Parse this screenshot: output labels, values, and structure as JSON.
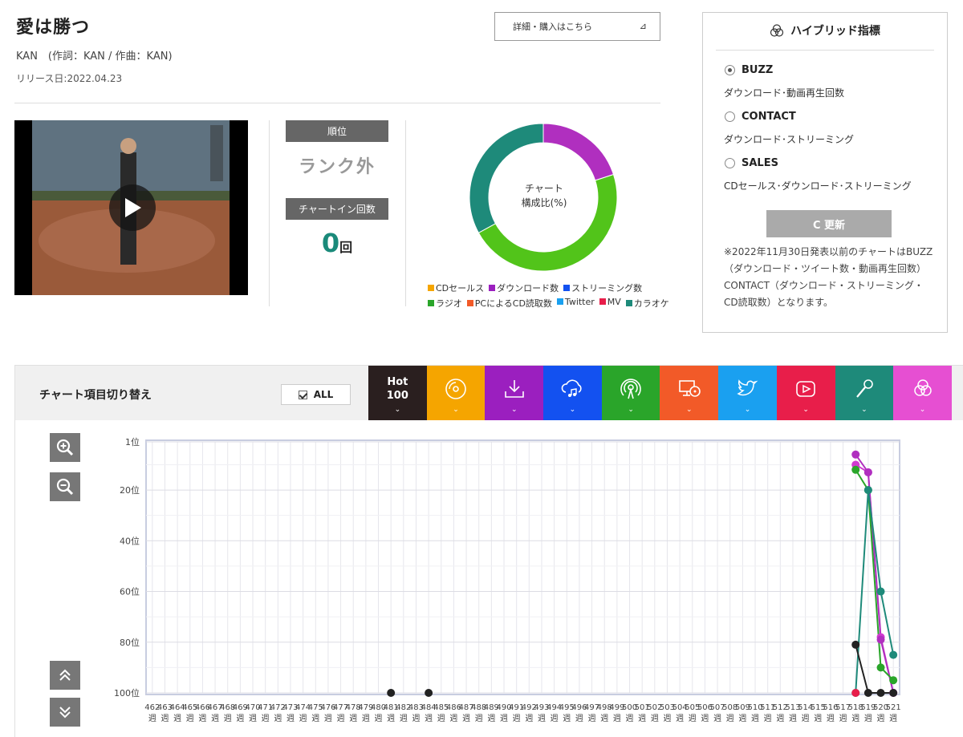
{
  "song": {
    "title": "愛は勝つ",
    "artist_line": "KAN　(作詞：KAN / 作曲：KAN)",
    "release": "リリース日:2022.04.23",
    "detail_button": "詳細・購入はこちら",
    "detail_arrow": "⊿"
  },
  "stats": {
    "rank_label": "順位",
    "rank_value": "ランク外",
    "chart_in_label": "チャートイン回数",
    "chart_in_count": "0",
    "chart_in_unit": "回"
  },
  "donut": {
    "center_line1": "チャート",
    "center_line2": "構成比(%)",
    "slices": [
      {
        "name": "ダウンロード数",
        "value": 20,
        "color": "#b02fbf"
      },
      {
        "name": "ラジオ",
        "value": 47,
        "color": "#52c41a"
      },
      {
        "name": "カラオケ",
        "value": 33,
        "color": "#1e8a7a"
      }
    ],
    "legend_row1": [
      {
        "label": "CDセールス",
        "color": "#f5a500"
      },
      {
        "label": "ダウンロード数",
        "color": "#9b1fbf"
      },
      {
        "label": "ストリーミング数",
        "color": "#1351f0"
      }
    ],
    "legend_row2": [
      {
        "label": "ラジオ",
        "color": "#2aa52a"
      },
      {
        "label": "PCによるCD読取数",
        "color": "#f25a28"
      },
      {
        "label": "Twitter",
        "color": "#1aa0f0"
      },
      {
        "label": "MV",
        "color": "#e81e4a"
      },
      {
        "label": "カラオケ",
        "color": "#1e8a7a"
      }
    ]
  },
  "hybrid": {
    "title": "ハイブリッド指標",
    "options": [
      {
        "label": "BUZZ",
        "desc": "ダウンロード･動画再生回数",
        "selected": true
      },
      {
        "label": "CONTACT",
        "desc": "ダウンロード･ストリーミング",
        "selected": false
      },
      {
        "label": "SALES",
        "desc": "CDセールス･ダウンロード･ストリーミング",
        "selected": false
      }
    ],
    "refresh_label": "C 更新",
    "note": "※2022年11月30日発表以前のチャートはBUZZ（ダウンロード・ツイート数・動画再生回数）CONTACT（ダウンロード・ストリーミング・CD読取数）となります。"
  },
  "chart_panel": {
    "title": "チャート項目切り替え",
    "all_label": "ALL",
    "hot_line1": "Hot",
    "hot_line2": "100",
    "categories": [
      {
        "name": "hot100",
        "color": "#2a1f1f",
        "icon": "hot100"
      },
      {
        "name": "cd-sales",
        "color": "#f5a500",
        "icon": "disc-icon"
      },
      {
        "name": "download",
        "color": "#9b1fbf",
        "icon": "download-icon"
      },
      {
        "name": "streaming",
        "color": "#1351f0",
        "icon": "cloud-music-icon"
      },
      {
        "name": "radio",
        "color": "#2aa52a",
        "icon": "radio-icon"
      },
      {
        "name": "pc-cd-read",
        "color": "#f25a28",
        "icon": "pc-disc-icon"
      },
      {
        "name": "twitter",
        "color": "#1aa0f0",
        "icon": "twitter-icon"
      },
      {
        "name": "mv",
        "color": "#e81e4a",
        "icon": "video-icon"
      },
      {
        "name": "karaoke",
        "color": "#1e8a7a",
        "icon": "mic-icon"
      },
      {
        "name": "hybrid",
        "color": "#e64fd2",
        "icon": "hybrid-icon"
      }
    ]
  },
  "chart_data": {
    "type": "line",
    "y_tick_labels": [
      "1位",
      "20位",
      "40位",
      "60位",
      "80位",
      "100位"
    ],
    "y_ticks": [
      1,
      20,
      40,
      60,
      80,
      100
    ],
    "ylim": [
      1,
      100
    ],
    "y_inverted": true,
    "x_labels": [
      "462",
      "463",
      "464",
      "465",
      "466",
      "467",
      "468",
      "469",
      "470",
      "471",
      "472",
      "473",
      "474",
      "475",
      "476",
      "477",
      "478",
      "479",
      "480",
      "481",
      "482",
      "483",
      "484",
      "485",
      "486",
      "487",
      "488",
      "489",
      "490",
      "491",
      "492",
      "493",
      "494",
      "495",
      "496",
      "497",
      "498",
      "499",
      "500",
      "501",
      "502",
      "503",
      "504",
      "505",
      "506",
      "507",
      "508",
      "509",
      "510",
      "511",
      "512",
      "513",
      "514",
      "515",
      "516",
      "517",
      "518",
      "519",
      "520",
      "521"
    ],
    "x_suffix": "週",
    "series": [
      {
        "color": "#d03ad0",
        "points": [
          [
            56,
            10
          ],
          [
            57,
            13
          ],
          [
            58,
            78
          ],
          [
            59,
            100
          ]
        ]
      },
      {
        "color": "#b02fbf",
        "points": [
          [
            56,
            6
          ],
          [
            57,
            13
          ],
          [
            58,
            79
          ],
          [
            59,
            100
          ]
        ]
      },
      {
        "color": "#2aa52a",
        "points": [
          [
            56,
            12
          ],
          [
            57,
            20
          ],
          [
            58,
            90
          ],
          [
            59,
            95
          ]
        ]
      },
      {
        "color": "#1e8a7a",
        "points": [
          [
            56,
            100
          ],
          [
            57,
            20
          ],
          [
            58,
            60
          ],
          [
            59,
            85
          ]
        ]
      },
      {
        "color": "#e81e4a",
        "points": [
          [
            56,
            100
          ]
        ]
      },
      {
        "color": "#222222",
        "points": [
          [
            19,
            100
          ],
          [
            22,
            100
          ],
          [
            56,
            81
          ],
          [
            57,
            100
          ],
          [
            58,
            100
          ],
          [
            59,
            100
          ]
        ]
      }
    ]
  }
}
